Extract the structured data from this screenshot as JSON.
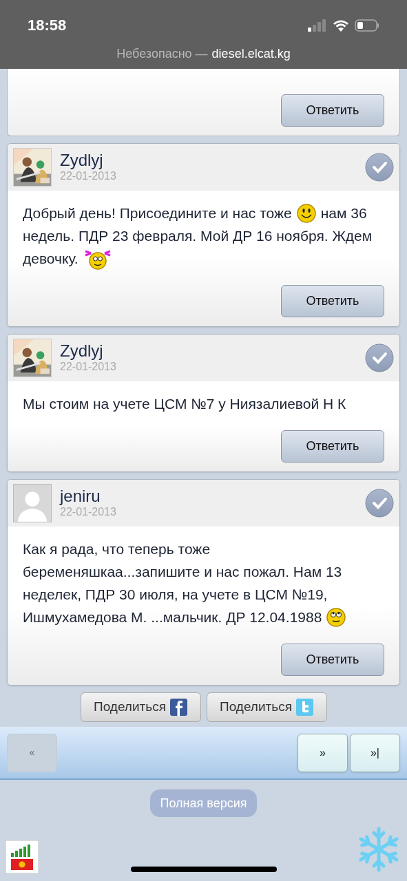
{
  "status_bar": {
    "time": "18:58",
    "security": "Небезопасно —",
    "url": "diesel.elcat.kg"
  },
  "partial_post": {
    "reply": "Ответить"
  },
  "posts": [
    {
      "author": "Zydlyj",
      "date": "22-01-2013",
      "lines": [
        [
          {
            "kind": "text",
            "text": "Добрый день! Присоедините и нас тоже"
          },
          {
            "kind": "smiley"
          },
          {
            "kind": "text",
            "text": "нам 36"
          }
        ],
        [
          {
            "kind": "text",
            "text": "недель. ПДР 23 февраля. Мой ДР 16 ноября. Ждем"
          }
        ],
        [
          {
            "kind": "text",
            "text": "девочку."
          },
          {
            "kind": "girl-smiley"
          }
        ]
      ],
      "reply": "Ответить"
    },
    {
      "author": "Zydlyj",
      "date": "22-01-2013",
      "lines": [
        [
          {
            "kind": "text",
            "text": "Мы стоим на учете ЦСМ №7 у Ниязалиевой Н К"
          }
        ]
      ],
      "reply": "Ответить"
    },
    {
      "author": "jeniru",
      "date": "22-01-2013",
      "kind": "silhouette",
      "lines": [
        [
          {
            "kind": "text",
            "text": "Как я рада, что теперь тоже"
          }
        ],
        [
          {
            "kind": "text",
            "text": "беременяшкаа...запишите и нас пожал. Нам 13"
          }
        ],
        [
          {
            "kind": "text",
            "text": "неделек, ПДР 30 июля, на учете в ЦСМ №19,"
          }
        ],
        [
          {
            "kind": "text",
            "text": "Ишмухамедова М. ...мальчик. ДР 12.04.1988"
          },
          {
            "kind": "rolleyes"
          }
        ]
      ],
      "reply": "Ответить"
    }
  ],
  "share": [
    {
      "label": "Поделиться",
      "kind": "facebook"
    },
    {
      "label": "Поделиться",
      "kind": "twitter"
    }
  ],
  "pager": {
    "back": [
      {
        "label": "«",
        "disabled": true
      }
    ],
    "forward": [
      {
        "label": "»",
        "disabled": false
      },
      {
        "label": "»|",
        "disabled": false
      }
    ]
  },
  "full_version": "Полная версия"
}
